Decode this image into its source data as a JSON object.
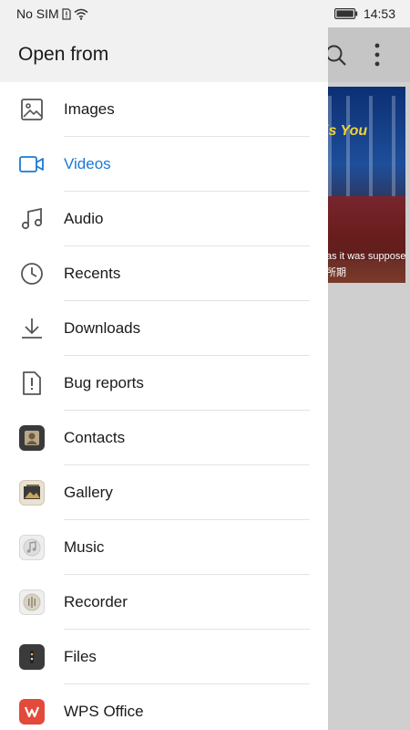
{
  "status_bar": {
    "carrier": "No SIM",
    "time": "14:53"
  },
  "drawer": {
    "title": "Open from",
    "items": [
      {
        "label": "Images",
        "icon": "image-icon",
        "active": false
      },
      {
        "label": "Videos",
        "icon": "video-camera-icon",
        "active": true
      },
      {
        "label": "Audio",
        "icon": "music-note-icon",
        "active": false
      },
      {
        "label": "Recents",
        "icon": "clock-icon",
        "active": false
      },
      {
        "label": "Downloads",
        "icon": "download-icon",
        "active": false
      },
      {
        "label": "Bug reports",
        "icon": "bug-report-icon",
        "active": false
      },
      {
        "label": "Contacts",
        "icon": "contacts-app-icon",
        "active": false
      },
      {
        "label": "Gallery",
        "icon": "gallery-app-icon",
        "active": false
      },
      {
        "label": "Music",
        "icon": "music-app-icon",
        "active": false
      },
      {
        "label": "Recorder",
        "icon": "recorder-app-icon",
        "active": false
      },
      {
        "label": "Files",
        "icon": "files-app-icon",
        "active": false
      },
      {
        "label": "WPS Office",
        "icon": "wps-office-app-icon",
        "active": false
      }
    ]
  },
  "background": {
    "thumbnail_title": "is You",
    "thumbnail_subtitle": "as it was suppose",
    "thumbnail_caption_cn": "所期"
  },
  "colors": {
    "accent": "#1a7ad4",
    "text": "#1a1a1a",
    "header_bg": "#f1f1f1",
    "scrim": "#c9c9c9"
  }
}
